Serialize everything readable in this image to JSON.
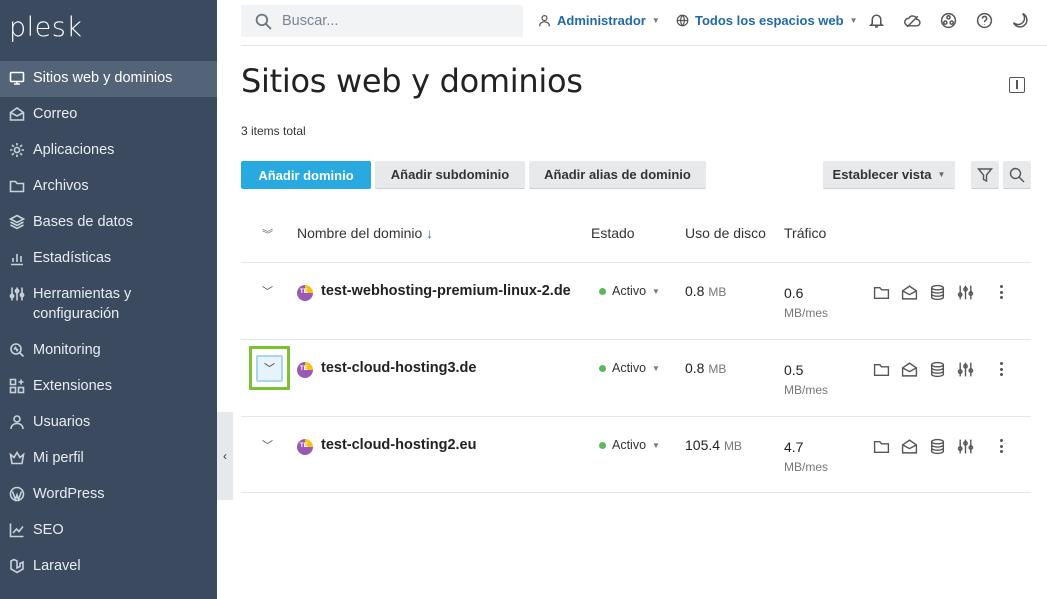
{
  "app": {
    "logo": "plesk"
  },
  "sidebar": {
    "items": [
      {
        "label": "Sitios web y dominios",
        "icon": "monitor-icon",
        "active": true
      },
      {
        "label": "Correo",
        "icon": "mail-icon"
      },
      {
        "label": "Aplicaciones",
        "icon": "gear-icon"
      },
      {
        "label": "Archivos",
        "icon": "folder-icon"
      },
      {
        "label": "Bases de datos",
        "icon": "database-icon"
      },
      {
        "label": "Estadísticas",
        "icon": "bar-chart-icon"
      },
      {
        "label": "Herramientas y configuración",
        "icon": "sliders-icon"
      },
      {
        "label": "Monitoring",
        "icon": "magnifier-icon"
      },
      {
        "label": "Extensiones",
        "icon": "blocks-icon"
      },
      {
        "label": "Usuarios",
        "icon": "user-icon"
      },
      {
        "label": "Mi perfil",
        "icon": "crown-icon"
      },
      {
        "label": "WordPress",
        "icon": "wordpress-icon"
      },
      {
        "label": "SEO",
        "icon": "trend-icon"
      },
      {
        "label": "Laravel",
        "icon": "laravel-icon"
      }
    ],
    "collapse_glyph": "‹"
  },
  "topbar": {
    "search_placeholder": "Buscar...",
    "user_label": "Administrador",
    "subscription_label": "Todos los espacios web",
    "icons": [
      "bell-icon",
      "cloud-icon",
      "globe-icon",
      "help-icon",
      "moon-icon"
    ]
  },
  "page": {
    "title": "Sitios web y dominios",
    "total": "3 items total"
  },
  "toolbar": {
    "add_domain": "Añadir dominio",
    "add_subdomain": "Añadir subdominio",
    "add_alias": "Añadir alias de dominio",
    "set_view": "Establecer vista"
  },
  "table": {
    "headers": {
      "domain": "Nombre del dominio",
      "sort_arrow": "↓",
      "status": "Estado",
      "disk": "Uso de disco",
      "traffic": "Tráfico"
    },
    "rows": [
      {
        "domain": "test-webhosting-premium-linux-2.de",
        "status": "Activo",
        "disk_value": "0.8",
        "disk_unit": "MB",
        "traffic_value": "0.6",
        "traffic_unit": "MB/mes"
      },
      {
        "domain": "test-cloud-hosting3.de",
        "status": "Activo",
        "disk_value": "0.8",
        "disk_unit": "MB",
        "traffic_value": "0.5",
        "traffic_unit": "MB/mes"
      },
      {
        "domain": "test-cloud-hosting2.eu",
        "status": "Activo",
        "disk_value": "105.4",
        "disk_unit": "MB",
        "traffic_value": "4.7",
        "traffic_unit": "MB/mes"
      }
    ]
  },
  "colors": {
    "sidebar": "#3b4a5e",
    "primary": "#28a9e0",
    "highlight": "#7ac136",
    "status_active": "#5cb85c"
  }
}
